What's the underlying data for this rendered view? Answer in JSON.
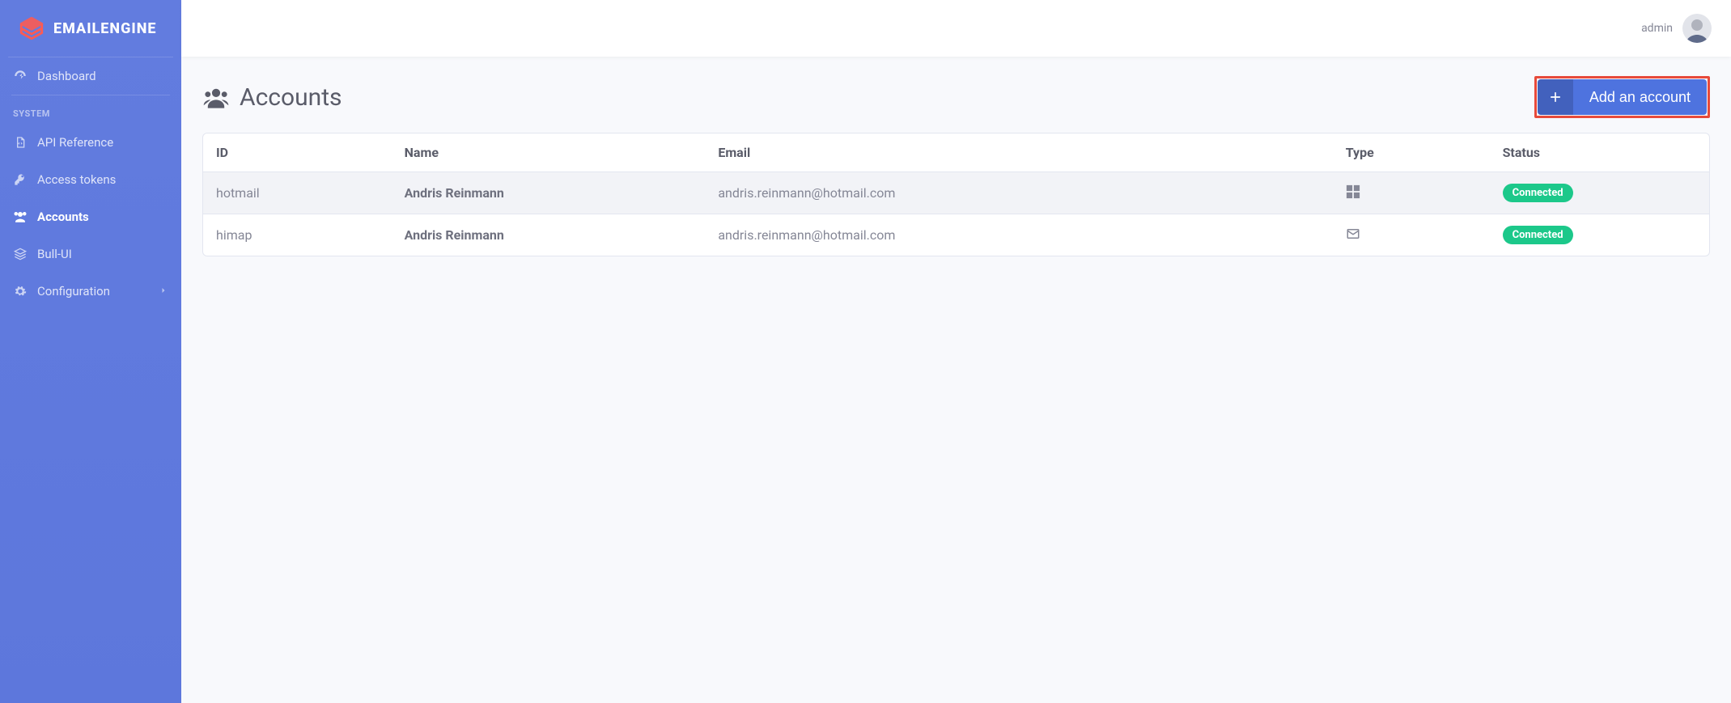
{
  "brand": {
    "name": "EMAILENGINE"
  },
  "topbar": {
    "username": "admin"
  },
  "sidebar": {
    "dashboard_label": "Dashboard",
    "section_system": "SYSTEM",
    "api_reference_label": "API Reference",
    "access_tokens_label": "Access tokens",
    "accounts_label": "Accounts",
    "bull_ui_label": "Bull-UI",
    "configuration_label": "Configuration"
  },
  "page": {
    "title": "Accounts",
    "add_button": "Add an account"
  },
  "table": {
    "headers": {
      "id": "ID",
      "name": "Name",
      "email": "Email",
      "type": "Type",
      "status": "Status"
    },
    "rows": [
      {
        "id": "hotmail",
        "name": "Andris Reinmann",
        "email": "andris.reinmann@hotmail.com",
        "type": "windows",
        "status": "Connected"
      },
      {
        "id": "himap",
        "name": "Andris Reinmann",
        "email": "andris.reinmann@hotmail.com",
        "type": "envelope",
        "status": "Connected"
      }
    ]
  },
  "colors": {
    "primary": "#4e73df",
    "success": "#1cc88a",
    "highlight_border": "#e74a3b"
  }
}
